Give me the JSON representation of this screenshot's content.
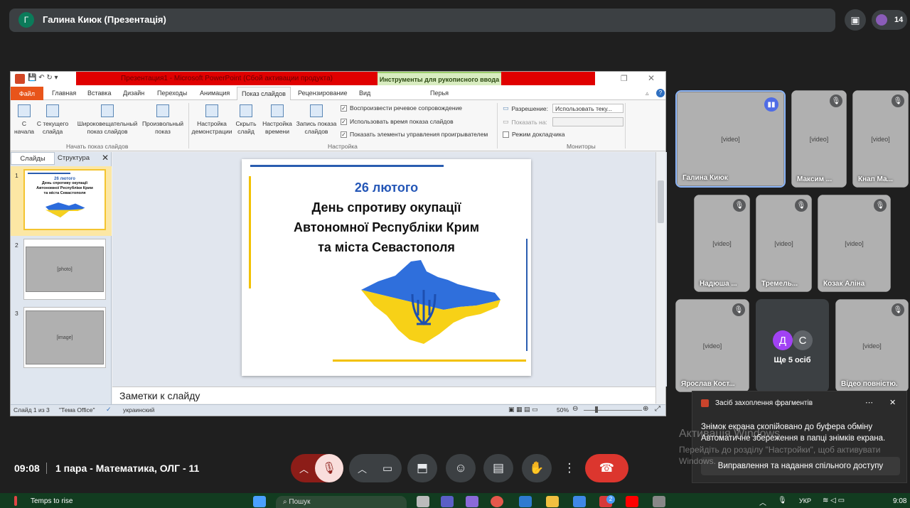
{
  "meet": {
    "presenter_initial": "Г",
    "presenter_title": "Галина Киюк (Презентація)",
    "participants_count": "14",
    "time": "09:08",
    "meeting_name": "1 пара - Математика, ОЛГ - 11"
  },
  "ppt": {
    "title": "Презентация1 - Microsoft PowerPoint (Сбой активации продукта)",
    "ink_tools": "Инструменты для рукописного ввода",
    "ink_tab": "Перья",
    "tabs": [
      "Файл",
      "Главная",
      "Вставка",
      "Дизайн",
      "Переходы",
      "Анимация",
      "Показ слайдов",
      "Рецензирование",
      "Вид"
    ],
    "ribbon": {
      "b1": "С\nначала",
      "b2": "С текущего\nслайда",
      "b3": "Широковещательный\nпоказ слайдов",
      "b4": "Произвольный\nпоказ",
      "g1": "Начать показ слайдов",
      "b5": "Настройка\nдемонстрации",
      "b6": "Скрыть\nслайд",
      "b7": "Настройка\nвремени",
      "b8": "Запись показа\nслайдов",
      "c1": "Воспроизвести речевое сопровождение",
      "c2": "Использовать время показа слайдов",
      "c3": "Показать элементы управления проигрывателем",
      "g2": "Настройка",
      "res_label": "Разрешение:",
      "res_value": "Использовать теку...",
      "show_label": "Показать на:",
      "presenter": "Режим докладчика",
      "g3": "Мониторы"
    },
    "pane_tabs": [
      "Слайды",
      "Структура"
    ],
    "slide": {
      "date": "26 лютого",
      "line1": "День спротиву окупації",
      "line2": "Автономної Республіки Крим",
      "line3": "та міста Севастополя"
    },
    "thumb1": {
      "date": "26 лютого",
      "l1": "День спротиву окупації",
      "l2": "Автономної Республіки Крим",
      "l3": "та міста Севастополя"
    },
    "notes": "Заметки к слайду",
    "status": {
      "slide": "Слайд 1 из 3",
      "theme": "\"Тема Office\"",
      "lang": "украинский",
      "zoom": "50%"
    }
  },
  "tiles": [
    {
      "name": "Галина Киюк"
    },
    {
      "name": "Максим ..."
    },
    {
      "name": "Кнап Ма..."
    },
    {
      "name": "Надюша ..."
    },
    {
      "name": "Тремель..."
    },
    {
      "name": "Козак Аліна"
    },
    {
      "name": "Ярослав Кост..."
    },
    {
      "name": "Ще 5 осіб"
    },
    {
      "name": "Відео повністю."
    }
  ],
  "more": {
    "d": "Д",
    "c": "С"
  },
  "toast": {
    "app": "Засіб захоплення фрагментів",
    "msg1": "Знімок екрана скопійовано до буфера обміну",
    "msg2": "Автоматичне збереження в папці знімків екрана.",
    "action": "Виправлення та надання спільного доступу"
  },
  "activation": {
    "title": "Активація Windows",
    "text": "Перейдіть до розділу \"Настройки\", щоб активувати Windows."
  },
  "taskbar": {
    "weather": "Temps to rise",
    "search": "Пошук",
    "lang": "УКР",
    "time": "9:08",
    "badge": "2"
  }
}
